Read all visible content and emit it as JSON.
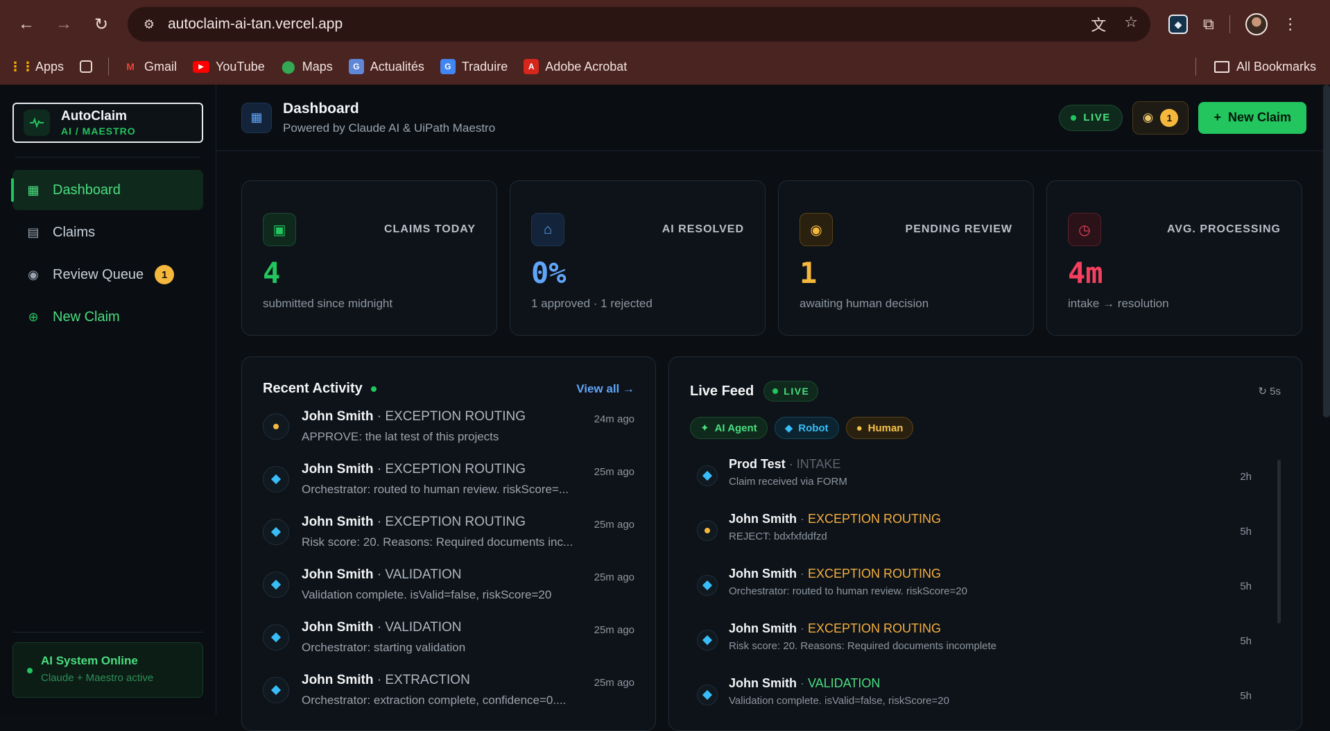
{
  "browser": {
    "url": "autoclaim-ai-tan.vercel.app",
    "bookmarks": [
      {
        "label": "Apps",
        "icon": "apps-grid-icon"
      },
      {
        "label": "Gmail",
        "icon": "gmail-icon"
      },
      {
        "label": "YouTube",
        "icon": "youtube-icon"
      },
      {
        "label": "Maps",
        "icon": "maps-icon"
      },
      {
        "label": "Actualités",
        "icon": "news-icon"
      },
      {
        "label": "Traduire",
        "icon": "translate-icon"
      },
      {
        "label": "Adobe Acrobat",
        "icon": "acrobat-icon"
      }
    ],
    "all_bookmarks": "All Bookmarks"
  },
  "brand": {
    "title": "AutoClaim",
    "subtitle": "AI / MAESTRO"
  },
  "sidebar": {
    "items": [
      {
        "label": "Dashboard",
        "icon": "grid-icon",
        "active": true
      },
      {
        "label": "Claims",
        "icon": "document-icon"
      },
      {
        "label": "Review Queue",
        "icon": "eye-icon",
        "badge": "1"
      },
      {
        "label": "New Claim",
        "icon": "plus-circle-icon"
      }
    ],
    "status": {
      "title": "AI System Online",
      "subtitle": "Claude + Maestro active"
    }
  },
  "topbar": {
    "title": "Dashboard",
    "subtitle": "Powered by Claude AI & UiPath Maestro",
    "live": "LIVE",
    "review_count": "1",
    "new_claim": "New Claim"
  },
  "stats": [
    {
      "label": "CLAIMS TODAY",
      "value": "4",
      "sub": "submitted since midnight",
      "color": "#22c55e",
      "icon": "clipboard-icon"
    },
    {
      "label": "AI RESOLVED",
      "value": "0%",
      "sub": "1 approved · 1 rejected",
      "color": "#60a5fa",
      "icon": "robot-icon"
    },
    {
      "label": "PENDING REVIEW",
      "value": "1",
      "sub": "awaiting human decision",
      "color": "#f5b83d",
      "icon": "eye-icon"
    },
    {
      "label": "AVG. PROCESSING",
      "value": "4m",
      "sub": "intake → resolution",
      "color": "#f43f5e",
      "icon": "clock-icon"
    }
  ],
  "activity": {
    "title": "Recent Activity",
    "view_all": "View all →",
    "items": [
      {
        "name": "John Smith",
        "stage": "EXCEPTION ROUTING",
        "detail": "APPROVE: the lat test of this projects",
        "time": "24m ago",
        "kind": "human"
      },
      {
        "name": "John Smith",
        "stage": "EXCEPTION ROUTING",
        "detail": "Orchestrator: routed to human review. riskScore=...",
        "time": "25m ago",
        "kind": "robot"
      },
      {
        "name": "John Smith",
        "stage": "EXCEPTION ROUTING",
        "detail": "Risk score: 20. Reasons: Required documents inc...",
        "time": "25m ago",
        "kind": "robot"
      },
      {
        "name": "John Smith",
        "stage": "VALIDATION",
        "detail": "Validation complete. isValid=false, riskScore=20",
        "time": "25m ago",
        "kind": "robot"
      },
      {
        "name": "John Smith",
        "stage": "VALIDATION",
        "detail": "Orchestrator: starting validation",
        "time": "25m ago",
        "kind": "robot"
      },
      {
        "name": "John Smith",
        "stage": "EXTRACTION",
        "detail": "Orchestrator: extraction complete, confidence=0....",
        "time": "25m ago",
        "kind": "robot"
      }
    ]
  },
  "feed": {
    "title": "Live Feed",
    "live": "LIVE",
    "refresh": "↻ 5s",
    "filters": [
      {
        "label": "AI Agent"
      },
      {
        "label": "Robot"
      },
      {
        "label": "Human"
      }
    ],
    "items": [
      {
        "name": "Prod Test",
        "stage": "INTAKE",
        "detail": "Claim received via FORM",
        "time": "2h",
        "kind": "robot",
        "stage_type": "intake"
      },
      {
        "name": "John Smith",
        "stage": "EXCEPTION ROUTING",
        "detail": "REJECT: bdxfxfddfzd",
        "time": "5h",
        "kind": "human",
        "stage_type": "exception"
      },
      {
        "name": "John Smith",
        "stage": "EXCEPTION ROUTING",
        "detail": "Orchestrator: routed to human review. riskScore=20",
        "time": "5h",
        "kind": "robot",
        "stage_type": "exception"
      },
      {
        "name": "John Smith",
        "stage": "EXCEPTION ROUTING",
        "detail": "Risk score: 20. Reasons: Required documents incomplete",
        "time": "5h",
        "kind": "robot",
        "stage_type": "exception"
      },
      {
        "name": "John Smith",
        "stage": "VALIDATION",
        "detail": "Validation complete. isValid=false, riskScore=20",
        "time": "5h",
        "kind": "robot",
        "stage_type": "validation"
      }
    ]
  }
}
